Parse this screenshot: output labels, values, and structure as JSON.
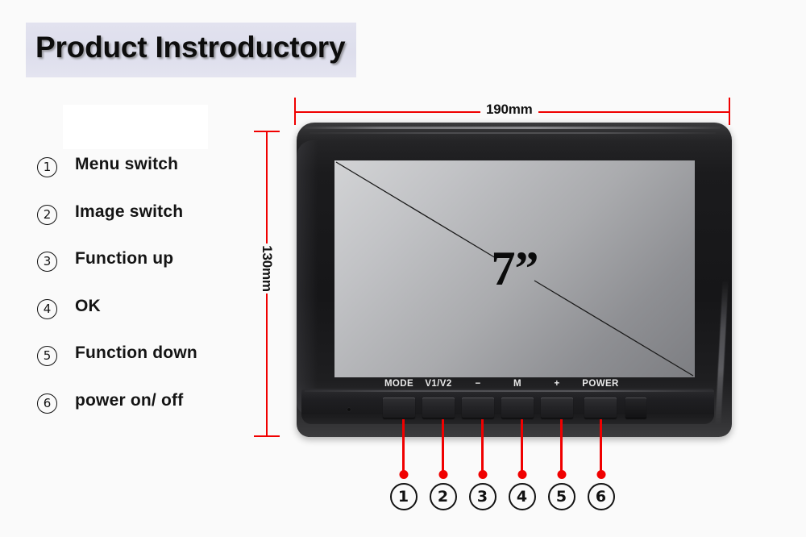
{
  "page": {
    "title": "Product Instroductory",
    "background_color": "#fafafa",
    "title_band_color": "#dfe0ee"
  },
  "legend": {
    "items": [
      {
        "number": "1",
        "label": "Menu  switch"
      },
      {
        "number": "2",
        "label": "Image switch"
      },
      {
        "number": "3",
        "label": "Function  up"
      },
      {
        "number": "4",
        "label": "OK"
      },
      {
        "number": "5",
        "label": "Function  down"
      },
      {
        "number": "6",
        "label": "power on/ off"
      }
    ]
  },
  "dimensions": {
    "width_label": "190mm",
    "height_label": "130mm",
    "line_color": "#f00000"
  },
  "monitor": {
    "screen_size_label": "7”",
    "buttons": [
      {
        "label": "MODE"
      },
      {
        "label": "V1/V2"
      },
      {
        "label": "−"
      },
      {
        "label": "M"
      },
      {
        "label": "+"
      },
      {
        "label": "POWER"
      }
    ],
    "callouts": [
      "1",
      "2",
      "3",
      "4",
      "5",
      "6"
    ]
  }
}
